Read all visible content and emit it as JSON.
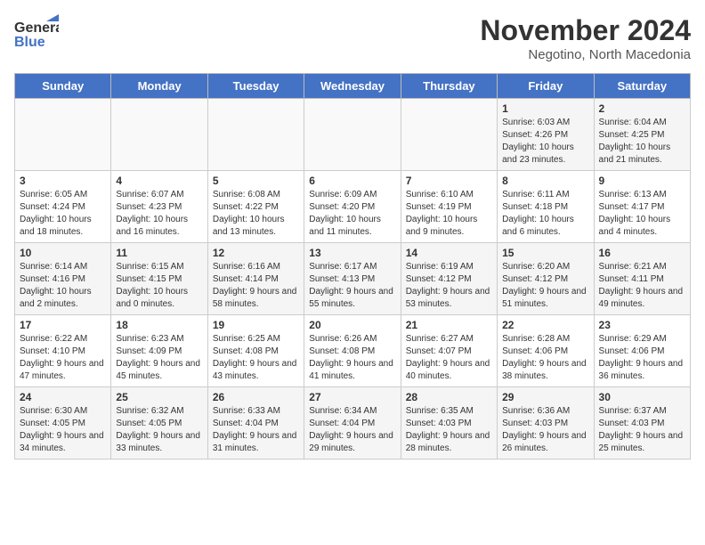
{
  "header": {
    "logo_line1": "General",
    "logo_line2": "Blue",
    "month": "November 2024",
    "location": "Negotino, North Macedonia"
  },
  "days_of_week": [
    "Sunday",
    "Monday",
    "Tuesday",
    "Wednesday",
    "Thursday",
    "Friday",
    "Saturday"
  ],
  "weeks": [
    [
      {
        "day": "",
        "info": ""
      },
      {
        "day": "",
        "info": ""
      },
      {
        "day": "",
        "info": ""
      },
      {
        "day": "",
        "info": ""
      },
      {
        "day": "",
        "info": ""
      },
      {
        "day": "1",
        "info": "Sunrise: 6:03 AM\nSunset: 4:26 PM\nDaylight: 10 hours and 23 minutes."
      },
      {
        "day": "2",
        "info": "Sunrise: 6:04 AM\nSunset: 4:25 PM\nDaylight: 10 hours and 21 minutes."
      }
    ],
    [
      {
        "day": "3",
        "info": "Sunrise: 6:05 AM\nSunset: 4:24 PM\nDaylight: 10 hours and 18 minutes."
      },
      {
        "day": "4",
        "info": "Sunrise: 6:07 AM\nSunset: 4:23 PM\nDaylight: 10 hours and 16 minutes."
      },
      {
        "day": "5",
        "info": "Sunrise: 6:08 AM\nSunset: 4:22 PM\nDaylight: 10 hours and 13 minutes."
      },
      {
        "day": "6",
        "info": "Sunrise: 6:09 AM\nSunset: 4:20 PM\nDaylight: 10 hours and 11 minutes."
      },
      {
        "day": "7",
        "info": "Sunrise: 6:10 AM\nSunset: 4:19 PM\nDaylight: 10 hours and 9 minutes."
      },
      {
        "day": "8",
        "info": "Sunrise: 6:11 AM\nSunset: 4:18 PM\nDaylight: 10 hours and 6 minutes."
      },
      {
        "day": "9",
        "info": "Sunrise: 6:13 AM\nSunset: 4:17 PM\nDaylight: 10 hours and 4 minutes."
      }
    ],
    [
      {
        "day": "10",
        "info": "Sunrise: 6:14 AM\nSunset: 4:16 PM\nDaylight: 10 hours and 2 minutes."
      },
      {
        "day": "11",
        "info": "Sunrise: 6:15 AM\nSunset: 4:15 PM\nDaylight: 10 hours and 0 minutes."
      },
      {
        "day": "12",
        "info": "Sunrise: 6:16 AM\nSunset: 4:14 PM\nDaylight: 9 hours and 58 minutes."
      },
      {
        "day": "13",
        "info": "Sunrise: 6:17 AM\nSunset: 4:13 PM\nDaylight: 9 hours and 55 minutes."
      },
      {
        "day": "14",
        "info": "Sunrise: 6:19 AM\nSunset: 4:12 PM\nDaylight: 9 hours and 53 minutes."
      },
      {
        "day": "15",
        "info": "Sunrise: 6:20 AM\nSunset: 4:12 PM\nDaylight: 9 hours and 51 minutes."
      },
      {
        "day": "16",
        "info": "Sunrise: 6:21 AM\nSunset: 4:11 PM\nDaylight: 9 hours and 49 minutes."
      }
    ],
    [
      {
        "day": "17",
        "info": "Sunrise: 6:22 AM\nSunset: 4:10 PM\nDaylight: 9 hours and 47 minutes."
      },
      {
        "day": "18",
        "info": "Sunrise: 6:23 AM\nSunset: 4:09 PM\nDaylight: 9 hours and 45 minutes."
      },
      {
        "day": "19",
        "info": "Sunrise: 6:25 AM\nSunset: 4:08 PM\nDaylight: 9 hours and 43 minutes."
      },
      {
        "day": "20",
        "info": "Sunrise: 6:26 AM\nSunset: 4:08 PM\nDaylight: 9 hours and 41 minutes."
      },
      {
        "day": "21",
        "info": "Sunrise: 6:27 AM\nSunset: 4:07 PM\nDaylight: 9 hours and 40 minutes."
      },
      {
        "day": "22",
        "info": "Sunrise: 6:28 AM\nSunset: 4:06 PM\nDaylight: 9 hours and 38 minutes."
      },
      {
        "day": "23",
        "info": "Sunrise: 6:29 AM\nSunset: 4:06 PM\nDaylight: 9 hours and 36 minutes."
      }
    ],
    [
      {
        "day": "24",
        "info": "Sunrise: 6:30 AM\nSunset: 4:05 PM\nDaylight: 9 hours and 34 minutes."
      },
      {
        "day": "25",
        "info": "Sunrise: 6:32 AM\nSunset: 4:05 PM\nDaylight: 9 hours and 33 minutes."
      },
      {
        "day": "26",
        "info": "Sunrise: 6:33 AM\nSunset: 4:04 PM\nDaylight: 9 hours and 31 minutes."
      },
      {
        "day": "27",
        "info": "Sunrise: 6:34 AM\nSunset: 4:04 PM\nDaylight: 9 hours and 29 minutes."
      },
      {
        "day": "28",
        "info": "Sunrise: 6:35 AM\nSunset: 4:03 PM\nDaylight: 9 hours and 28 minutes."
      },
      {
        "day": "29",
        "info": "Sunrise: 6:36 AM\nSunset: 4:03 PM\nDaylight: 9 hours and 26 minutes."
      },
      {
        "day": "30",
        "info": "Sunrise: 6:37 AM\nSunset: 4:03 PM\nDaylight: 9 hours and 25 minutes."
      }
    ]
  ]
}
